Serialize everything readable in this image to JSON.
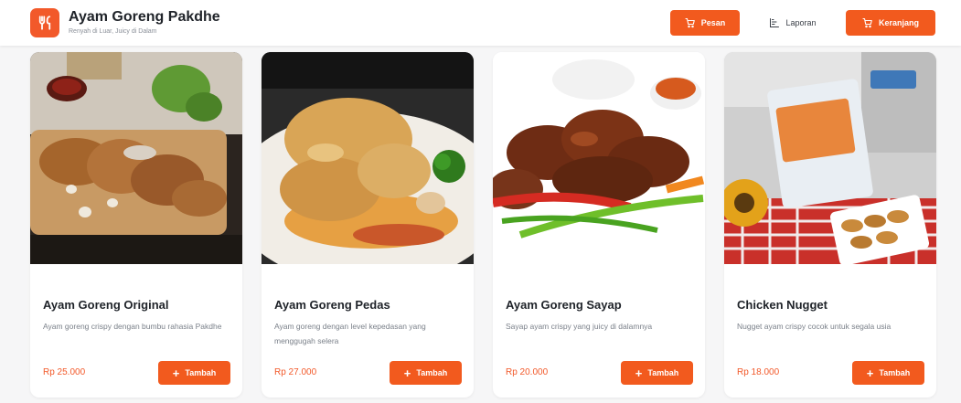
{
  "brand": {
    "title": "Ayam Goreng Pakdhe",
    "subtitle": "Renyah di Luar, Juicy di Dalam",
    "logo_icon": "utensils-icon"
  },
  "nav": {
    "pesan": "Pesan",
    "laporan": "Laporan",
    "keranjang": "Keranjang"
  },
  "colors": {
    "accent": "#f25a1e",
    "price": "#f2592a"
  },
  "currency_add_label": "Tambah",
  "menu": [
    {
      "name": "Ayam Goreng Original",
      "description": "Ayam goreng crispy dengan bumbu rahasia Pakdhe",
      "price": "Rp 25.000",
      "add_label": "Tambah"
    },
    {
      "name": "Ayam Goreng Pedas",
      "description": "Ayam goreng dengan level kepedasan yang menggugah selera",
      "price": "Rp 27.000",
      "add_label": "Tambah"
    },
    {
      "name": "Ayam Goreng Sayap",
      "description": "Sayap ayam crispy yang juicy di dalamnya",
      "price": "Rp 20.000",
      "add_label": "Tambah"
    },
    {
      "name": "Chicken Nugget",
      "description": "Nugget ayam crispy cocok untuk segala usia",
      "price": "Rp 18.000",
      "add_label": "Tambah"
    }
  ]
}
